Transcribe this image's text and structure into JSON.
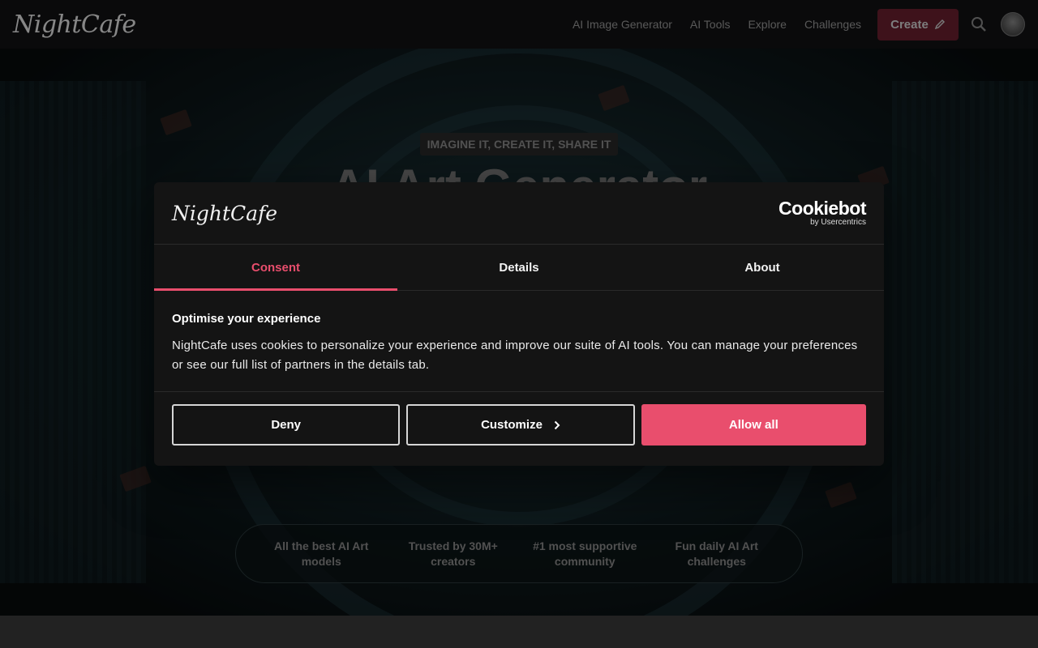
{
  "nav": {
    "logo": "NightCafe",
    "links": [
      "AI Image Generator",
      "AI Tools",
      "Explore",
      "Challenges"
    ],
    "create_label": "Create"
  },
  "hero": {
    "tagline": "IMAGINE IT, CREATE IT, SHARE IT",
    "title": "AI Art Generator",
    "features": [
      "All the best AI Art models",
      "Trusted by 30M+ creators",
      "#1 most supportive community",
      "Fun daily AI Art challenges"
    ]
  },
  "cookie_dialog": {
    "logo": "NightCafe",
    "provider": {
      "name": "Cookiebot",
      "sub": "by Usercentrics"
    },
    "tabs": [
      "Consent",
      "Details",
      "About"
    ],
    "active_tab": "Consent",
    "heading": "Optimise your experience",
    "text": "NightCafe uses cookies to personalize your experience and improve our suite of AI tools. You can manage your preferences or see our full list of partners in the details tab.",
    "buttons": {
      "deny": "Deny",
      "customize": "Customize",
      "allow": "Allow all"
    }
  },
  "colors": {
    "accent": "#e94e6d",
    "create_button": "#6b1f30"
  }
}
